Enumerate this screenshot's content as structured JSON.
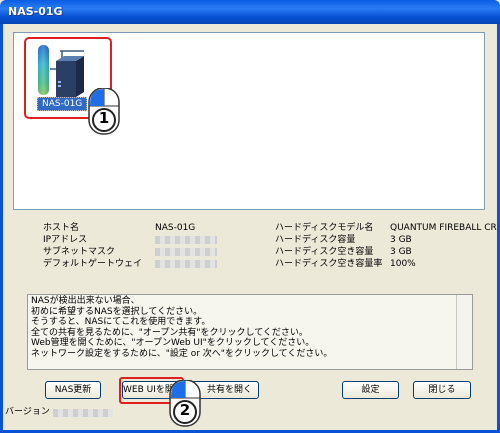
{
  "window": {
    "title": "NAS-01G"
  },
  "device": {
    "name": "NAS-01G"
  },
  "info_left": [
    {
      "label": "ホスト名",
      "value": "NAS-01G"
    },
    {
      "label": "IPアドレス",
      "value": ""
    },
    {
      "label": "サブネットマスク",
      "value": ""
    },
    {
      "label": "デフォルトゲートウェイ",
      "value": ""
    }
  ],
  "info_right": [
    {
      "label": "ハードディスクモデル名",
      "value": "QUANTUM FIREBALL CR"
    },
    {
      "label": "ハードディスク容量",
      "value": "3 GB"
    },
    {
      "label": "ハードディスク空き容量",
      "value": "3 GB"
    },
    {
      "label": "ハードディスク空き容量率",
      "value": "100%"
    }
  ],
  "message_lines": [
    "NASが検出出来ない場合、",
    "初めに希望するNASを選択してください。",
    "そうすると、NASにてこれを使用できます。",
    "全ての共有を見るために、\"オープン共有\"をクリックしてください。",
    "Web管理を開くために、\"オープンWeb UI\"をクリックしてください。",
    "ネットワーク設定をするために、\"設定 or 次へ\"をクリックしてください。"
  ],
  "buttons": {
    "nas_update": "NAS更新",
    "web_ui": "WEB UIを開く",
    "open_share": "共有を開く",
    "settings": "設定",
    "close": "閉じる"
  },
  "version": {
    "label": "バージョン"
  },
  "annotations": {
    "step1": "1",
    "step2": "2"
  },
  "colors": {
    "accent": "#e0201f",
    "selection": "#316ac5",
    "titlebar": "#0a5ce4"
  }
}
